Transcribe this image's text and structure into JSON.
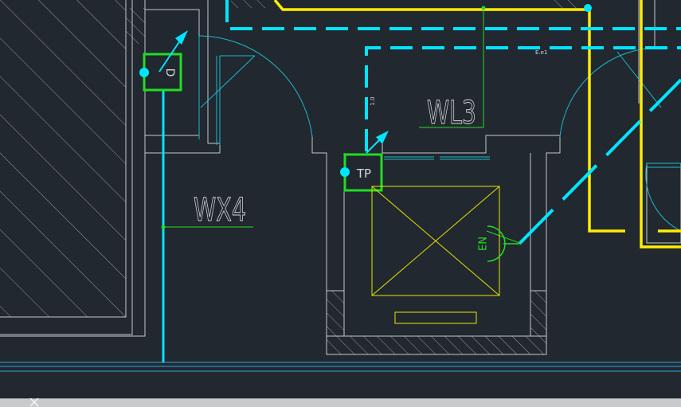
{
  "drawing": {
    "labels": {
      "wx4": "WX4",
      "wl3": "WL3"
    },
    "tags": {
      "d": "D",
      "tp": "TP",
      "en": "EN"
    },
    "annotations": {
      "slope_1": "1.0",
      "slope_2": "E.e1"
    }
  },
  "colors": {
    "background": "#212830",
    "wall": "#c8c8c8",
    "cyan_pipe": "#00e5ff",
    "yellow_pipe": "#ffee00",
    "green_tag": "#22dd22",
    "fixture_yellow": "#e6e600",
    "door_arc": "#1fb8c8",
    "hatch": "#9a9a9a",
    "floor_line": "#2aa8d8"
  }
}
